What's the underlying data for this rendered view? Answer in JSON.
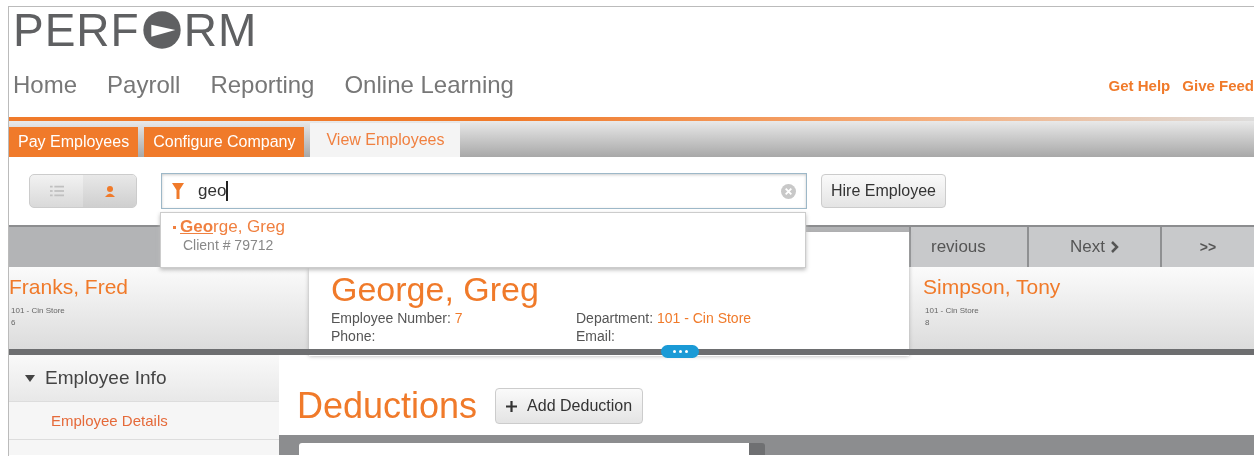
{
  "logo": {
    "left": "PERF",
    "right": "RM"
  },
  "nav": [
    "Home",
    "Payroll",
    "Reporting",
    "Online Learning"
  ],
  "links": [
    "Get Help",
    "Give Feed"
  ],
  "tabs": [
    {
      "label": "Pay Employees",
      "selected": false
    },
    {
      "label": "Configure Company",
      "selected": false
    },
    {
      "label": "View Employees",
      "selected": true
    }
  ],
  "view_toggle": [
    {
      "kind": "list",
      "selected": false
    },
    {
      "kind": "person",
      "selected": true
    }
  ],
  "search": {
    "value": "geo"
  },
  "hire_button": "Hire Employee",
  "suggestions": [
    {
      "name": "**Geo**rge, Greg",
      "client": "Client # 79712"
    }
  ],
  "pager": [
    {
      "kind": "previous",
      "label": "revious"
    },
    {
      "kind": "next",
      "label": "Next"
    },
    {
      "kind": "last",
      "label": ">>"
    }
  ],
  "previous_employee": {
    "name": "Franks, Fred",
    "department": "101 - Cin Store",
    "number": "6"
  },
  "current_employee": {
    "name": "George, Greg",
    "fields": [
      {
        "label": "Employee Number:",
        "value": "7"
      },
      {
        "label": "Department:",
        "value": "101 - Cin Store"
      },
      {
        "label": "Phone:"
      },
      {
        "label": "Email:"
      }
    ]
  },
  "next_employee": {
    "name": "Simpson, Tony",
    "department": "101 - Cin Store",
    "number": "8"
  },
  "sidebar": {
    "section": "Employee Info",
    "expanded": true,
    "items": [
      {
        "label": "Employee Details",
        "selected": true
      }
    ]
  },
  "page": {
    "title": "Deductions",
    "add_button": "Add Deduction"
  }
}
